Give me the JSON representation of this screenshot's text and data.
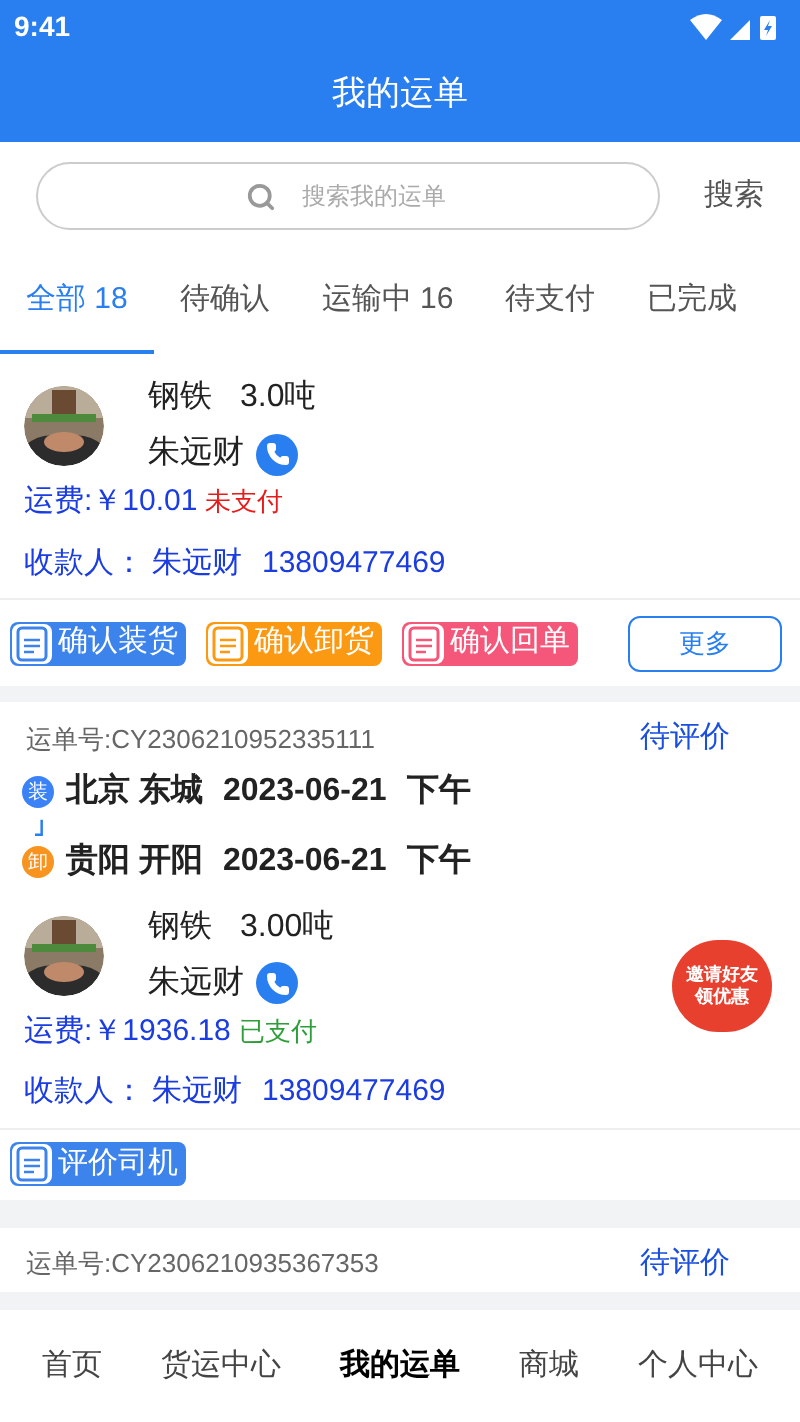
{
  "status_bar": {
    "time": "9:41"
  },
  "header": {
    "title": "我的运单"
  },
  "search": {
    "placeholder": "搜索我的运单",
    "button": "搜索"
  },
  "tabs": [
    {
      "label": "全部 18",
      "selected": true
    },
    {
      "label": "待确认",
      "selected": false
    },
    {
      "label": "运输中 16",
      "selected": false
    },
    {
      "label": "待支付",
      "selected": false
    },
    {
      "label": "已完成",
      "selected": false
    }
  ],
  "orders": [
    {
      "goods": "钢铁",
      "weight": "3.0吨",
      "contact": "朱远财",
      "freight_label": "运费:",
      "amount": "￥10.01",
      "payment": {
        "text": "未支付",
        "paid": false
      },
      "payee_label": "收款人：",
      "payee": "朱远财",
      "phone": "13809477469",
      "actions": [
        {
          "kind": "load",
          "label": "确认装货"
        },
        {
          "kind": "unload",
          "label": "确认卸货"
        },
        {
          "kind": "receipt",
          "label": "确认回单"
        }
      ],
      "more": "更多"
    },
    {
      "number": "运单号:CY2306210952335111",
      "status": "待评价",
      "route": [
        {
          "kind": "load",
          "badge": "装",
          "place": "北京 东城",
          "date": "2023-06-21",
          "period": "下午"
        },
        {
          "kind": "unload",
          "badge": "卸",
          "place": "贵阳 开阳",
          "date": "2023-06-21",
          "period": "下午"
        }
      ],
      "goods": "钢铁",
      "weight": "3.00吨",
      "contact": "朱远财",
      "freight_label": "运费:",
      "amount": "￥1936.18",
      "payment": {
        "text": "已支付",
        "paid": true
      },
      "payee_label": "收款人：",
      "payee": "朱远财",
      "phone": "13809477469",
      "actions": [
        {
          "kind": "rate",
          "label": "评价司机"
        }
      ],
      "promo": [
        "邀请好友",
        "领优惠"
      ]
    },
    {
      "number": "运单号:CY2306210935367353",
      "status": "待评价"
    }
  ],
  "bottom_nav": [
    {
      "label": "首页",
      "selected": false
    },
    {
      "label": "货运中心",
      "selected": false
    },
    {
      "label": "我的运单",
      "selected": true
    },
    {
      "label": "商城",
      "selected": false
    },
    {
      "label": "个人中心",
      "selected": false
    }
  ]
}
